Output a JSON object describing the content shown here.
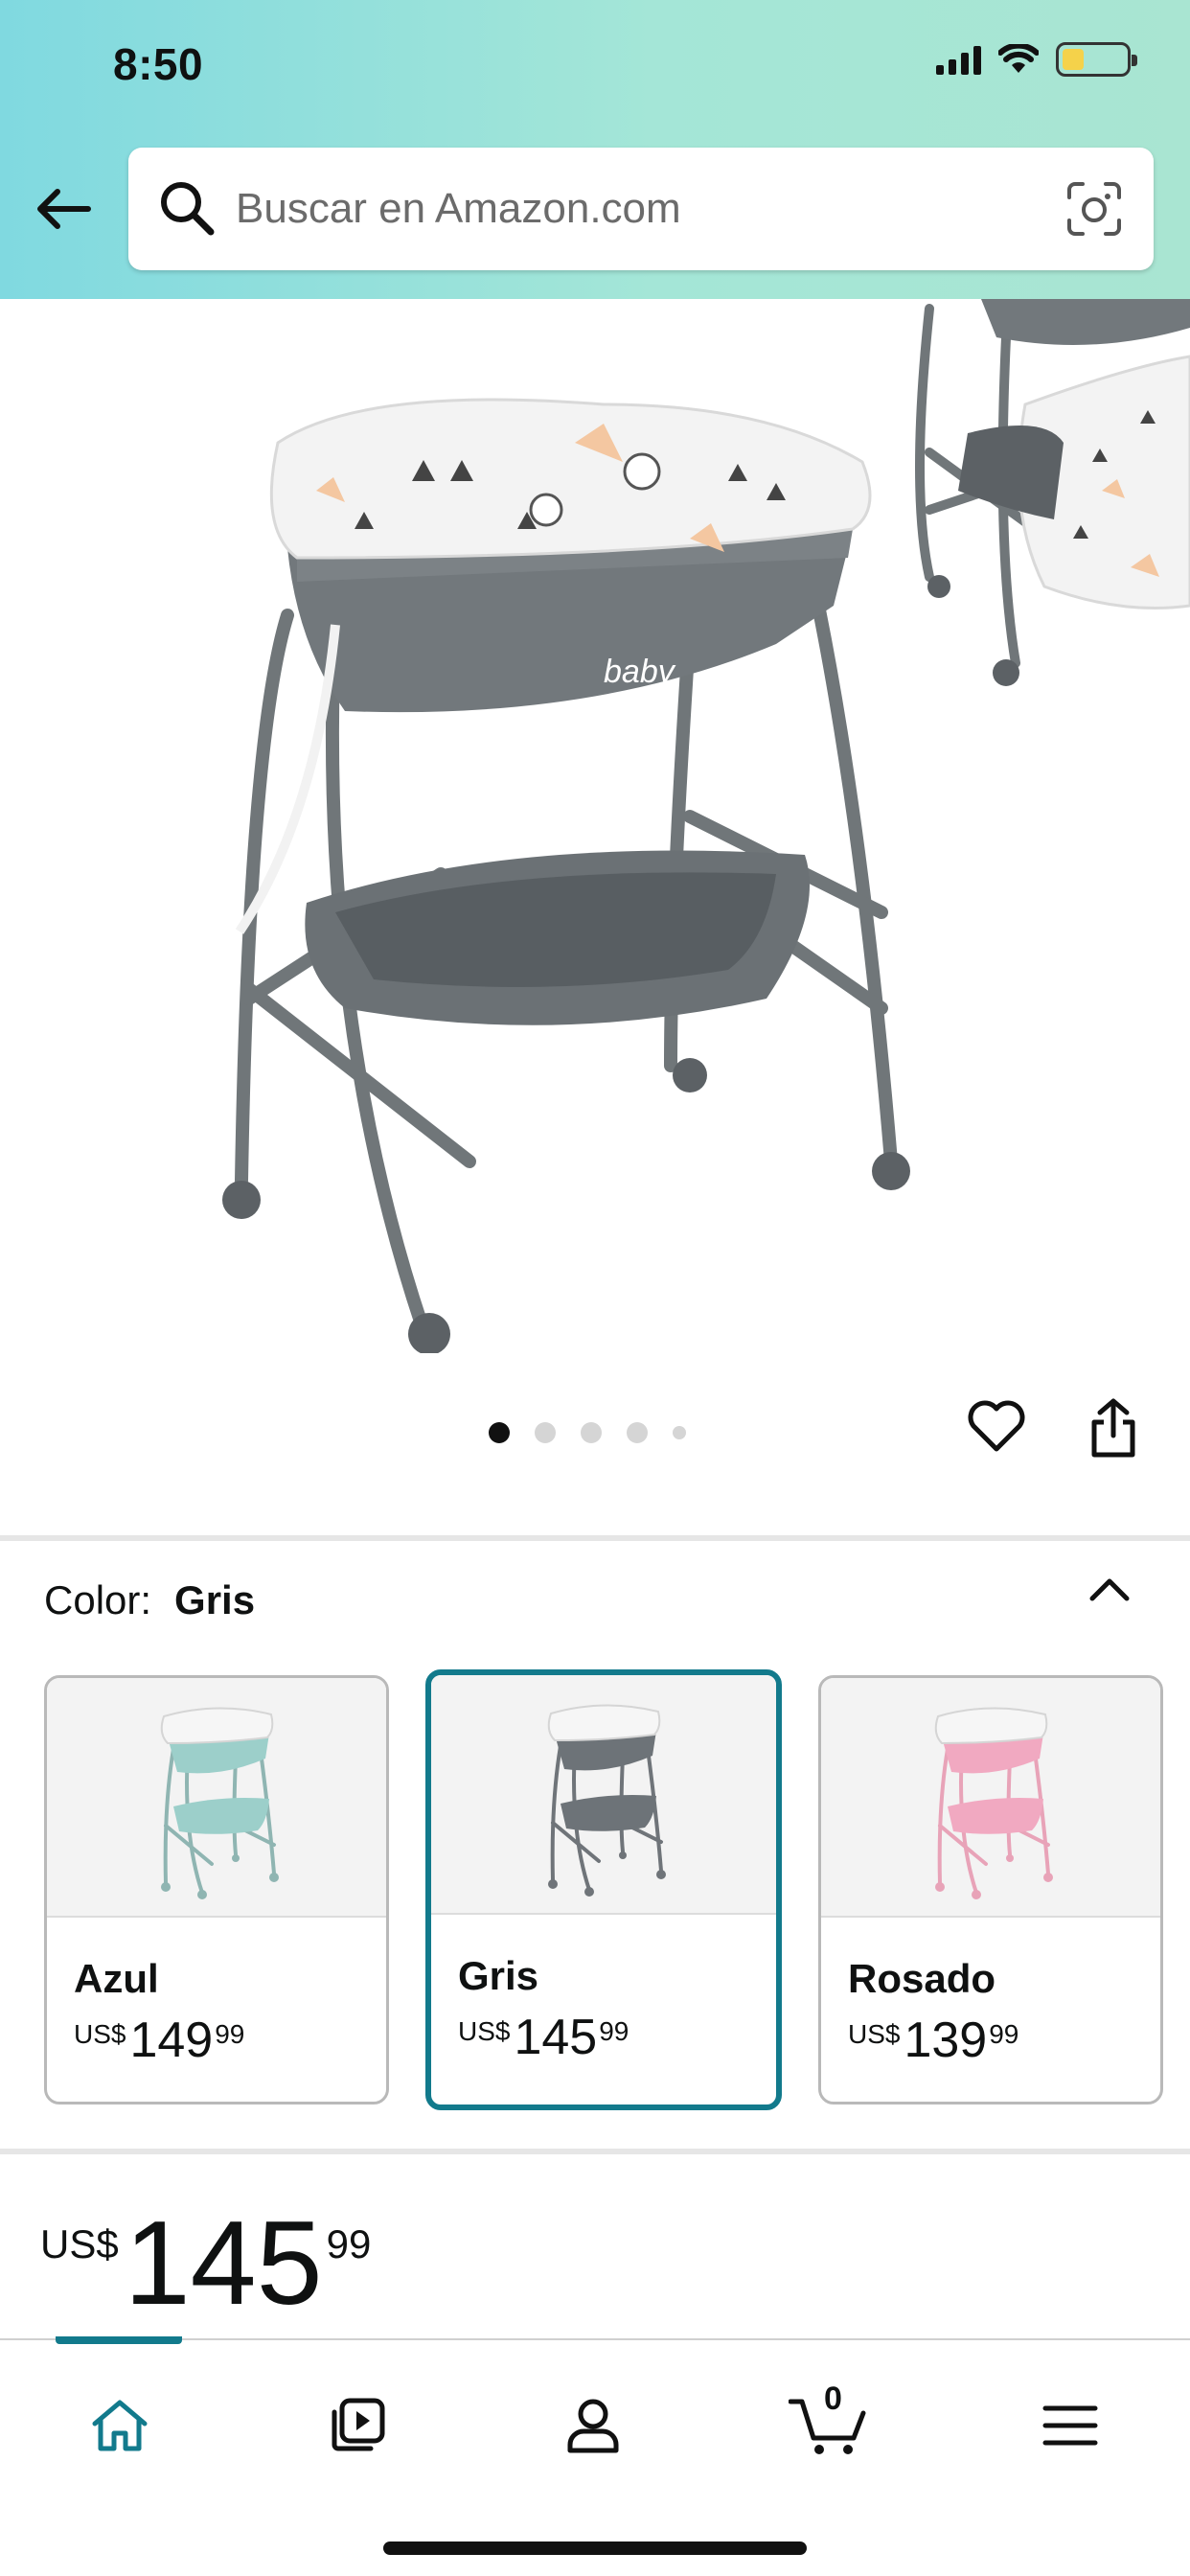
{
  "status_bar": {
    "time": "8:50"
  },
  "search": {
    "placeholder": "Buscar en Amazon.com"
  },
  "gallery": {
    "total_images": 5,
    "active_index": 0
  },
  "color_selector": {
    "label": "Color:",
    "selected": "Gris",
    "options": [
      {
        "name": "Azul",
        "currency": "US$",
        "whole": "149",
        "fraction": "99",
        "tint": "#9ccfca",
        "frame": "#8fb5b2"
      },
      {
        "name": "Gris",
        "currency": "US$",
        "whole": "145",
        "fraction": "99",
        "tint": "#6d7378",
        "frame": "#6f7479"
      },
      {
        "name": "Rosado",
        "currency": "US$",
        "whole": "139",
        "fraction": "99",
        "tint": "#f1a9c1",
        "frame": "#e8a3b8"
      }
    ]
  },
  "price": {
    "currency": "US$",
    "whole": "145",
    "fraction": "99"
  },
  "bottom_nav": {
    "items": [
      "home-icon",
      "video-icon",
      "account-icon",
      "cart-icon",
      "menu-icon"
    ],
    "cart_count": "0",
    "accent": "#127a8c"
  },
  "colors": {
    "selected_border": "#127a8c",
    "header_start": "#80d9e0",
    "header_end": "#a9e5d2"
  }
}
